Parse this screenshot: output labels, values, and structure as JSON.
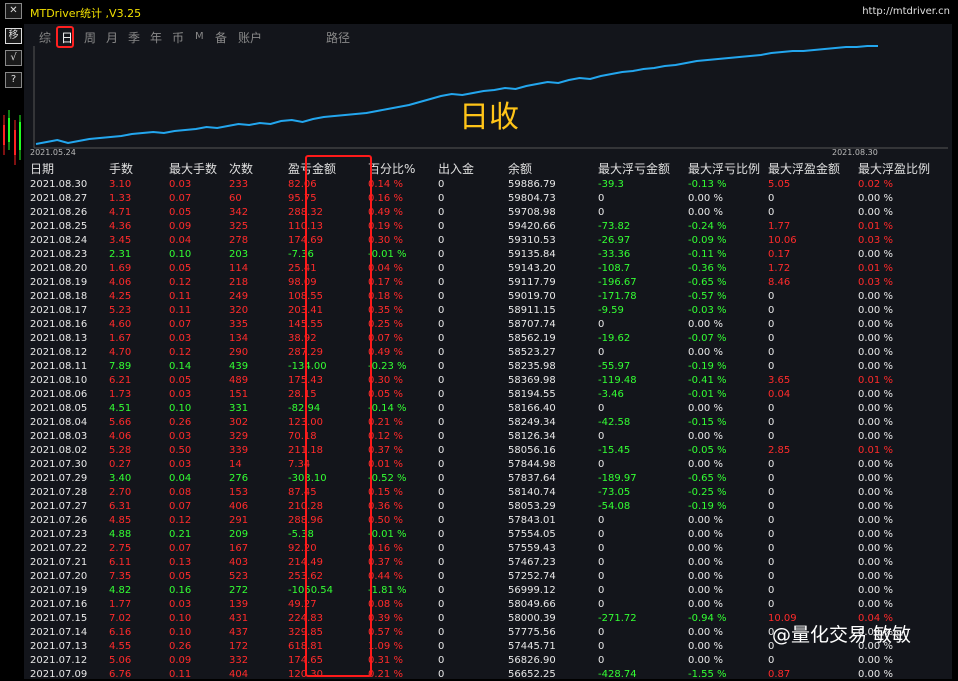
{
  "left_toolbar": {
    "btn_move": "移",
    "btn_check": "√",
    "btn_help": "?"
  },
  "window": {
    "title": "MTDriver统计 ,V3.25",
    "url": "http://mtdriver.cn"
  },
  "tabs": [
    {
      "label": "综"
    },
    {
      "label": "日",
      "selected": true
    },
    {
      "label": "周"
    },
    {
      "label": "月"
    },
    {
      "label": "季"
    },
    {
      "label": "年"
    },
    {
      "label": "币"
    },
    {
      "label": "M"
    },
    {
      "label": "备"
    },
    {
      "label": "账户"
    },
    {
      "label": "路径"
    }
  ],
  "chart": {
    "label": "日收",
    "start_date": "2021.05.24",
    "end_date": "2021.08.30",
    "line_color": "#23a6ee"
  },
  "chart_data": {
    "type": "line",
    "x_start": "2021.05.24",
    "x_end": "2021.08.30",
    "series": [
      {
        "values": [
          2,
          4,
          6,
          3,
          5,
          7,
          8,
          9,
          10,
          12,
          13,
          14,
          13,
          15,
          16,
          17,
          19,
          18,
          20,
          22,
          21,
          23,
          22,
          25,
          26,
          24,
          27,
          29,
          30,
          31,
          32,
          33,
          35,
          37,
          39,
          41,
          44,
          47,
          50,
          52,
          51,
          53,
          55,
          56,
          58,
          57,
          60,
          62,
          64,
          63,
          66,
          68,
          67,
          70,
          72,
          74,
          75,
          77,
          78,
          80,
          81,
          83,
          85,
          86,
          87,
          88,
          89,
          90,
          91,
          93,
          94,
          95,
          95,
          96,
          97,
          98,
          99,
          99,
          100,
          100
        ]
      }
    ],
    "colors": {
      "line": "#23a6ee",
      "profit_text": "#ff2b2b",
      "loss_text": "#33ff33"
    }
  },
  "table": {
    "headers": [
      "日期",
      "手数",
      "最大手数",
      "次数",
      "盈亏金额",
      "百分比%",
      "出入金",
      "余额",
      "最大浮亏金额",
      "最大浮亏比例",
      "最大浮盈金额",
      "最大浮盈比例"
    ],
    "rows": [
      [
        "2021.08.30",
        "3.10",
        "0.03",
        "233",
        "82.06",
        "0.14 %",
        "0",
        "59886.79",
        "-39.3",
        "-0.13 %",
        "5.05",
        "0.02 %"
      ],
      [
        "2021.08.27",
        "1.33",
        "0.07",
        "60",
        "95.75",
        "0.16 %",
        "0",
        "59804.73",
        "0",
        "0.00 %",
        "0",
        "0.00 %"
      ],
      [
        "2021.08.26",
        "4.71",
        "0.05",
        "342",
        "288.32",
        "0.49 %",
        "0",
        "59708.98",
        "0",
        "0.00 %",
        "0",
        "0.00 %"
      ],
      [
        "2021.08.25",
        "4.36",
        "0.09",
        "325",
        "110.13",
        "0.19 %",
        "0",
        "59420.66",
        "-73.82",
        "-0.24 %",
        "1.77",
        "0.01 %"
      ],
      [
        "2021.08.24",
        "3.45",
        "0.04",
        "278",
        "174.69",
        "0.30 %",
        "0",
        "59310.53",
        "-26.97",
        "-0.09 %",
        "10.06",
        "0.03 %"
      ],
      [
        "2021.08.23",
        "2.31",
        "0.10",
        "203",
        "-7.36",
        "-0.01 %",
        "0",
        "59135.84",
        "-33.36",
        "-0.11 %",
        "0.17",
        "0.00 %"
      ],
      [
        "2021.08.20",
        "1.69",
        "0.05",
        "114",
        "25.41",
        "0.04 %",
        "0",
        "59143.20",
        "-108.7",
        "-0.36 %",
        "1.72",
        "0.01 %"
      ],
      [
        "2021.08.19",
        "4.06",
        "0.12",
        "218",
        "98.09",
        "0.17 %",
        "0",
        "59117.79",
        "-196.67",
        "-0.65 %",
        "8.46",
        "0.03 %"
      ],
      [
        "2021.08.18",
        "4.25",
        "0.11",
        "249",
        "108.55",
        "0.18 %",
        "0",
        "59019.70",
        "-171.78",
        "-0.57 %",
        "0",
        "0.00 %"
      ],
      [
        "2021.08.17",
        "5.23",
        "0.11",
        "320",
        "203.41",
        "0.35 %",
        "0",
        "58911.15",
        "-9.59",
        "-0.03 %",
        "0",
        "0.00 %"
      ],
      [
        "2021.08.16",
        "4.60",
        "0.07",
        "335",
        "145.55",
        "0.25 %",
        "0",
        "58707.74",
        "0",
        "0.00 %",
        "0",
        "0.00 %"
      ],
      [
        "2021.08.13",
        "1.67",
        "0.03",
        "134",
        "38.92",
        "0.07 %",
        "0",
        "58562.19",
        "-19.62",
        "-0.07 %",
        "0",
        "0.00 %"
      ],
      [
        "2021.08.12",
        "4.70",
        "0.12",
        "290",
        "287.29",
        "0.49 %",
        "0",
        "58523.27",
        "0",
        "0.00 %",
        "0",
        "0.00 %"
      ],
      [
        "2021.08.11",
        "7.89",
        "0.14",
        "439",
        "-134.00",
        "-0.23 %",
        "0",
        "58235.98",
        "-55.97",
        "-0.19 %",
        "0",
        "0.00 %"
      ],
      [
        "2021.08.10",
        "6.21",
        "0.05",
        "489",
        "175.43",
        "0.30 %",
        "0",
        "58369.98",
        "-119.48",
        "-0.41 %",
        "3.65",
        "0.01 %"
      ],
      [
        "2021.08.06",
        "1.73",
        "0.03",
        "151",
        "28.15",
        "0.05 %",
        "0",
        "58194.55",
        "-3.46",
        "-0.01 %",
        "0.04",
        "0.00 %"
      ],
      [
        "2021.08.05",
        "4.51",
        "0.10",
        "331",
        "-82.94",
        "-0.14 %",
        "0",
        "58166.40",
        "0",
        "0.00 %",
        "0",
        "0.00 %"
      ],
      [
        "2021.08.04",
        "5.66",
        "0.26",
        "302",
        "123.00",
        "0.21 %",
        "0",
        "58249.34",
        "-42.58",
        "-0.15 %",
        "0",
        "0.00 %"
      ],
      [
        "2021.08.03",
        "4.06",
        "0.03",
        "329",
        "70.18",
        "0.12 %",
        "0",
        "58126.34",
        "0",
        "0.00 %",
        "0",
        "0.00 %"
      ],
      [
        "2021.08.02",
        "5.28",
        "0.50",
        "339",
        "211.18",
        "0.37 %",
        "0",
        "58056.16",
        "-15.45",
        "-0.05 %",
        "2.85",
        "0.01 %"
      ],
      [
        "2021.07.30",
        "0.27",
        "0.03",
        "14",
        "7.34",
        "0.01 %",
        "0",
        "57844.98",
        "0",
        "0.00 %",
        "0",
        "0.00 %"
      ],
      [
        "2021.07.29",
        "3.40",
        "0.04",
        "276",
        "-303.10",
        "-0.52 %",
        "0",
        "57837.64",
        "-189.97",
        "-0.65 %",
        "0",
        "0.00 %"
      ],
      [
        "2021.07.28",
        "2.70",
        "0.08",
        "153",
        "87.45",
        "0.15 %",
        "0",
        "58140.74",
        "-73.05",
        "-0.25 %",
        "0",
        "0.00 %"
      ],
      [
        "2021.07.27",
        "6.31",
        "0.07",
        "406",
        "210.28",
        "0.36 %",
        "0",
        "58053.29",
        "-54.08",
        "-0.19 %",
        "0",
        "0.00 %"
      ],
      [
        "2021.07.26",
        "4.85",
        "0.12",
        "291",
        "288.96",
        "0.50 %",
        "0",
        "57843.01",
        "0",
        "0.00 %",
        "0",
        "0.00 %"
      ],
      [
        "2021.07.23",
        "4.88",
        "0.21",
        "209",
        "-5.38",
        "-0.01 %",
        "0",
        "57554.05",
        "0",
        "0.00 %",
        "0",
        "0.00 %"
      ],
      [
        "2021.07.22",
        "2.75",
        "0.07",
        "167",
        "92.20",
        "0.16 %",
        "0",
        "57559.43",
        "0",
        "0.00 %",
        "0",
        "0.00 %"
      ],
      [
        "2021.07.21",
        "6.11",
        "0.13",
        "403",
        "214.49",
        "0.37 %",
        "0",
        "57467.23",
        "0",
        "0.00 %",
        "0",
        "0.00 %"
      ],
      [
        "2021.07.20",
        "7.35",
        "0.05",
        "523",
        "253.62",
        "0.44 %",
        "0",
        "57252.74",
        "0",
        "0.00 %",
        "0",
        "0.00 %"
      ],
      [
        "2021.07.19",
        "4.82",
        "0.16",
        "272",
        "-1050.54",
        "-1.81 %",
        "0",
        "56999.12",
        "0",
        "0.00 %",
        "0",
        "0.00 %"
      ],
      [
        "2021.07.16",
        "1.77",
        "0.03",
        "139",
        "49.27",
        "0.08 %",
        "0",
        "58049.66",
        "0",
        "0.00 %",
        "0",
        "0.00 %"
      ],
      [
        "2021.07.15",
        "7.02",
        "0.10",
        "431",
        "224.83",
        "0.39 %",
        "0",
        "58000.39",
        "-271.72",
        "-0.94 %",
        "10.09",
        "0.04 %"
      ],
      [
        "2021.07.14",
        "6.16",
        "0.10",
        "437",
        "329.85",
        "0.57 %",
        "0",
        "57775.56",
        "0",
        "0.00 %",
        "0",
        "0.00 %"
      ],
      [
        "2021.07.13",
        "4.55",
        "0.26",
        "172",
        "618.81",
        "1.09 %",
        "0",
        "57445.71",
        "0",
        "0.00 %",
        "0",
        "0.00 %"
      ],
      [
        "2021.07.12",
        "5.06",
        "0.09",
        "332",
        "174.65",
        "0.31 %",
        "0",
        "56826.90",
        "0",
        "0.00 %",
        "0",
        "0.00 %"
      ],
      [
        "2021.07.09",
        "6.76",
        "0.11",
        "404",
        "120.30",
        "0.21 %",
        "0",
        "56652.25",
        "-428.74",
        "-1.55 %",
        "0.87",
        "0.00 %"
      ]
    ]
  },
  "watermark": "@量化交易 敏敏"
}
